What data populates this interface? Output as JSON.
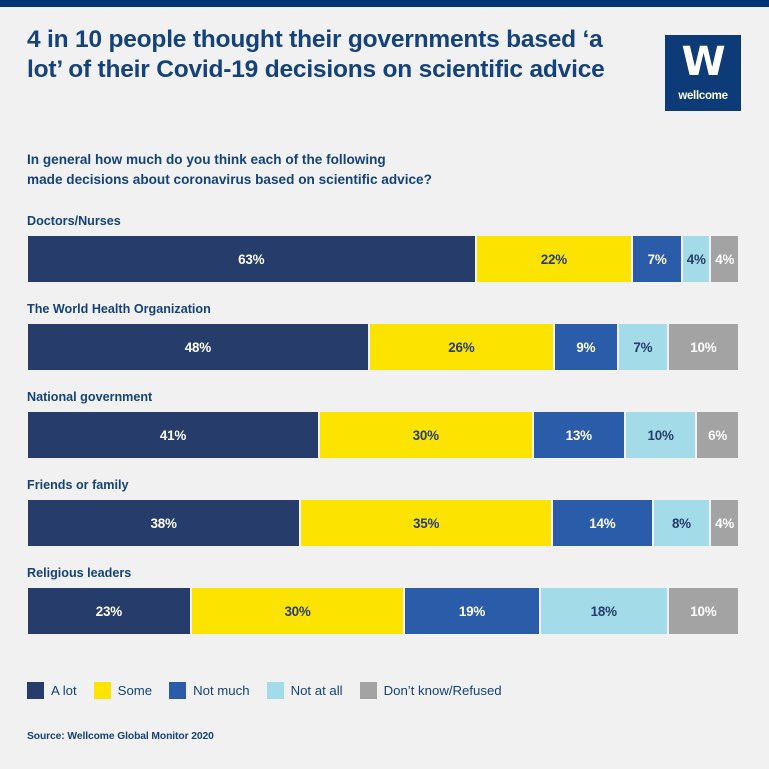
{
  "header": {
    "title": "4 in 10 people thought their governments based ‘a lot’ of their Covid-19 decisions on scientific advice",
    "subtitle_line1": "In general how much do you think each of the following",
    "subtitle_line2": "made decisions about coronavirus based on scientific advice?",
    "logo_mark": "W",
    "logo_wordmark": "wellcome"
  },
  "source": "Source: Wellcome Global Monitor 2020",
  "colors": {
    "navy": "#263C6B",
    "yellow": "#FCE300",
    "blue": "#2A5CAA",
    "lightblue": "#A3DCE8",
    "grey": "#A3A3A3",
    "text_navy": "#14427C",
    "background": "#F1F1F1",
    "top_rule": "#003478"
  },
  "chart_data": {
    "type": "bar",
    "subtype": "stacked-horizontal-100",
    "title": "4 in 10 people thought their governments based ‘a lot’ of their Covid-19 decisions on scientific advice",
    "subtitle": "In general how much do you think each of the following made decisions about coronavirus based on scientific advice?",
    "xlabel": "",
    "ylabel": "",
    "xlim": [
      0,
      100
    ],
    "unit": "%",
    "grid": false,
    "legend_position": "bottom-left",
    "categories": [
      "Doctors/Nurses",
      "The World Health Organization",
      "National government",
      "Friends or family",
      "Religious leaders"
    ],
    "series": [
      {
        "name": "A lot",
        "color": "#263C6B",
        "label_color": "#FFFFFF",
        "values": [
          63,
          48,
          41,
          38,
          23
        ]
      },
      {
        "name": "Some",
        "color": "#FCE300",
        "label_color": "#263C6B",
        "values": [
          22,
          26,
          30,
          35,
          30
        ]
      },
      {
        "name": "Not much",
        "color": "#2A5CAA",
        "label_color": "#FFFFFF",
        "values": [
          7,
          9,
          13,
          14,
          19
        ]
      },
      {
        "name": "Not at all",
        "color": "#A3DCE8",
        "label_color": "#263C6B",
        "values": [
          4,
          7,
          10,
          8,
          18
        ]
      },
      {
        "name": "Don’t know/Refused",
        "color": "#A3A3A3",
        "label_color": "#FFFFFF",
        "values": [
          4,
          10,
          6,
          4,
          10
        ]
      }
    ],
    "value_labels": [
      [
        "63%",
        "22%",
        "7%",
        "4%",
        "4%"
      ],
      [
        "48%",
        "26%",
        "9%",
        "7%",
        "10%"
      ],
      [
        "41%",
        "30%",
        "13%",
        "10%",
        "6%"
      ],
      [
        "38%",
        "35%",
        "14%",
        "8%",
        "4%"
      ],
      [
        "23%",
        "30%",
        "19%",
        "18%",
        "10%"
      ]
    ]
  }
}
